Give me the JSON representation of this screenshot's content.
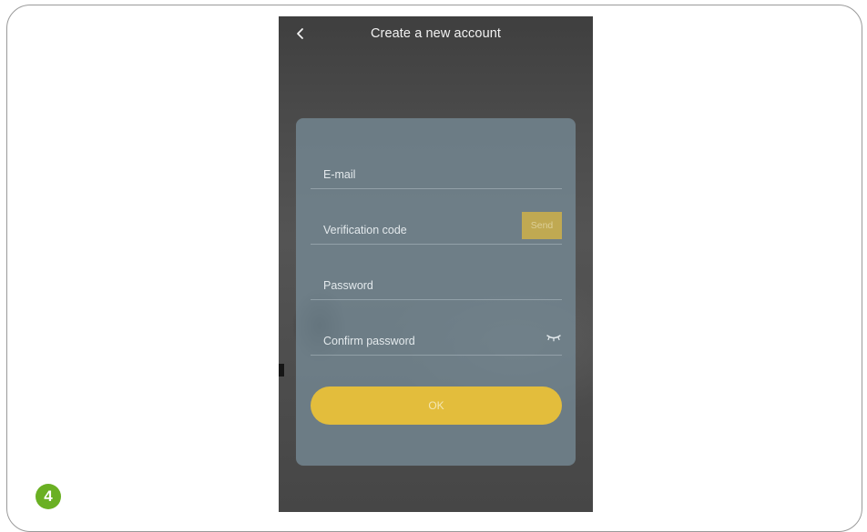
{
  "header": {
    "title": "Create a new account",
    "back_icon": "chevron-left-icon"
  },
  "form": {
    "email": {
      "placeholder": "E-mail",
      "value": ""
    },
    "verification_code": {
      "placeholder": "Verification code",
      "value": "",
      "send_label": "Send"
    },
    "password": {
      "placeholder": "Password",
      "value": ""
    },
    "confirm_password": {
      "placeholder": "Confirm password",
      "value": "",
      "toggle_icon": "eye-closed-icon"
    },
    "ok_label": "OK"
  },
  "step_badge": {
    "label": "4",
    "color": "#6ab023"
  },
  "colors": {
    "accent": "#e3bd3c",
    "send_button": "#c0a952",
    "card": "#768a96",
    "overlay": "#4a4a4a"
  }
}
